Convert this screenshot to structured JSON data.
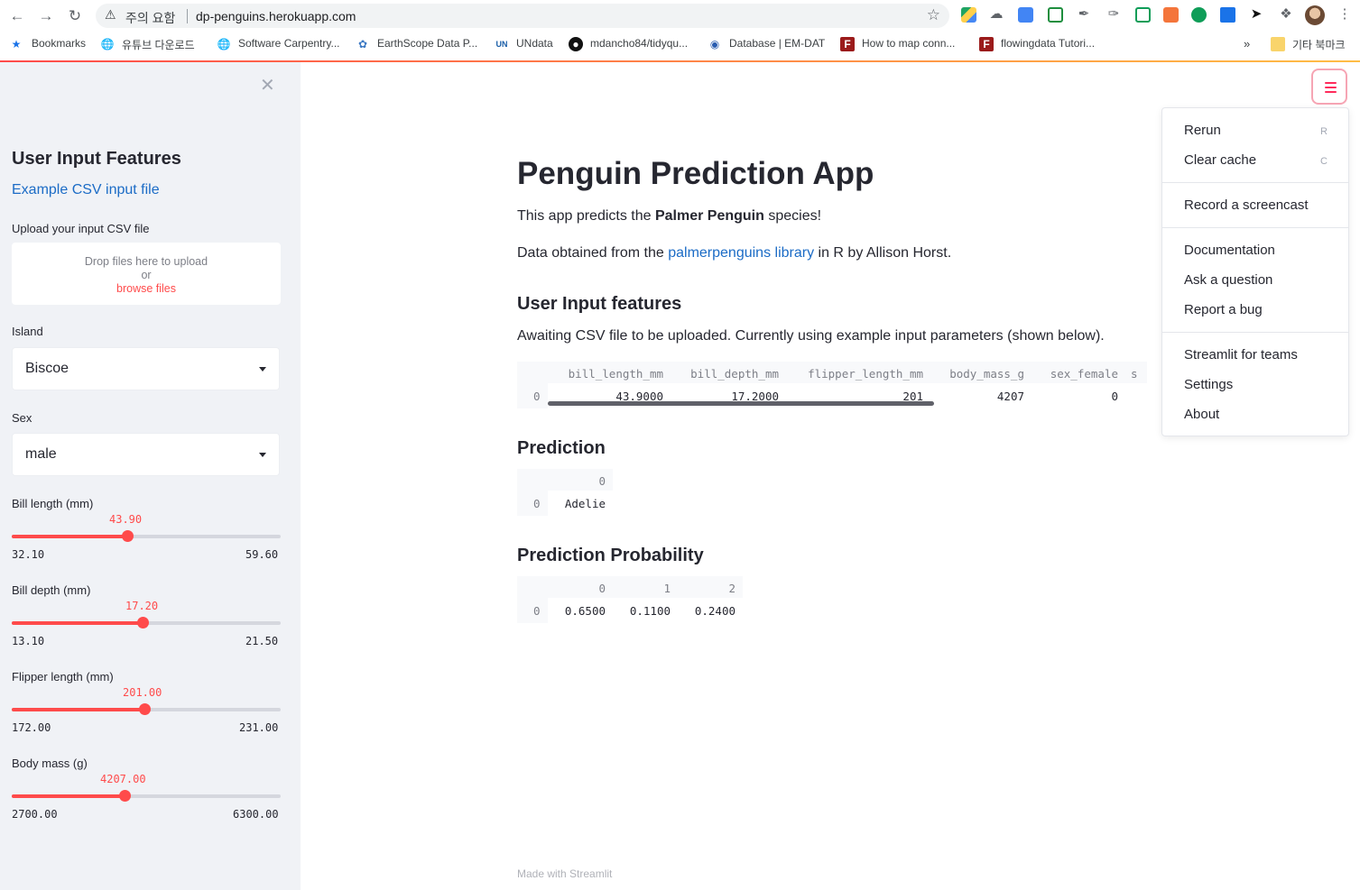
{
  "browser": {
    "security_warning": "주의 요함",
    "url": "dp-penguins.herokuapp.com",
    "bookmarks": [
      {
        "label": "Bookmarks",
        "icon": "star-icon"
      },
      {
        "label": "유튜브 다운로드",
        "icon": "globe-icon"
      },
      {
        "label": "Software Carpentry...",
        "icon": "globe-icon"
      },
      {
        "label": "EarthScope Data P...",
        "icon": "earthscope-icon"
      },
      {
        "label": "UNdata",
        "icon": "un-icon"
      },
      {
        "label": "mdancho84/tidyqu...",
        "icon": "github-icon"
      },
      {
        "label": "Database | EM-DAT",
        "icon": "emdat-icon"
      },
      {
        "label": "How to map conn...",
        "icon": "flowingdata-icon"
      },
      {
        "label": "flowingdata Tutori...",
        "icon": "flowingdata-icon"
      }
    ],
    "overflow": "»",
    "other_bookmarks": "기타 북마크"
  },
  "sidebar": {
    "title": "User Input Features",
    "example_link": "Example CSV input file",
    "upload_label": "Upload your input CSV file",
    "dropzone": {
      "line1": "Drop files here to upload",
      "line2": "or",
      "browse": "browse files"
    },
    "island": {
      "label": "Island",
      "value": "Biscoe"
    },
    "sex": {
      "label": "Sex",
      "value": "male"
    },
    "sliders": [
      {
        "label": "Bill length (mm)",
        "value": "43.90",
        "min": "32.10",
        "max": "59.60",
        "fraction": 0.429
      },
      {
        "label": "Bill depth (mm)",
        "value": "17.20",
        "min": "13.10",
        "max": "21.50",
        "fraction": 0.488
      },
      {
        "label": "Flipper length (mm)",
        "value": "201.00",
        "min": "172.00",
        "max": "231.00",
        "fraction": 0.492
      },
      {
        "label": "Body mass (g)",
        "value": "4207.00",
        "min": "2700.00",
        "max": "6300.00",
        "fraction": 0.419
      }
    ]
  },
  "main": {
    "title": "Penguin Prediction App",
    "intro_pre": "This app predicts the ",
    "intro_bold": "Palmer Penguin",
    "intro_post": " species!",
    "data_pre": "Data obtained from the ",
    "data_link": "palmerpenguins library",
    "data_post": " in R by Allison Horst.",
    "input_heading": "User Input features",
    "input_note": "Awaiting CSV file to be uploaded. Currently using example input parameters (shown below).",
    "input_table": {
      "columns": [
        "bill_length_mm",
        "bill_depth_mm",
        "flipper_length_mm",
        "body_mass_g",
        "sex_female",
        "s"
      ],
      "rows": [
        {
          "index": "0",
          "cells": [
            "43.9000",
            "17.2000",
            "201",
            "4207",
            "0"
          ]
        }
      ]
    },
    "prediction_heading": "Prediction",
    "prediction_table": {
      "columns": [
        "0"
      ],
      "rows": [
        {
          "index": "0",
          "cells": [
            "Adelie"
          ]
        }
      ]
    },
    "probability_heading": "Prediction Probability",
    "probability_table": {
      "columns": [
        "0",
        "1",
        "2"
      ],
      "rows": [
        {
          "index": "0",
          "cells": [
            "0.6500",
            "0.1100",
            "0.2400"
          ]
        }
      ]
    },
    "footer": "Made with Streamlit"
  },
  "menu": {
    "items": [
      {
        "label": "Rerun",
        "shortcut": "R"
      },
      {
        "label": "Clear cache",
        "shortcut": "C"
      },
      {
        "label": "Record a screencast",
        "shortcut": ""
      },
      {
        "label": "Documentation",
        "shortcut": ""
      },
      {
        "label": "Ask a question",
        "shortcut": ""
      },
      {
        "label": "Report a bug",
        "shortcut": ""
      },
      {
        "label": "Streamlit for teams",
        "shortcut": ""
      },
      {
        "label": "Settings",
        "shortcut": ""
      },
      {
        "label": "About",
        "shortcut": ""
      }
    ]
  },
  "colors": {
    "accent": "#ff4b4b",
    "link": "#1c6cc6",
    "sidebar_bg": "#f0f2f6"
  }
}
